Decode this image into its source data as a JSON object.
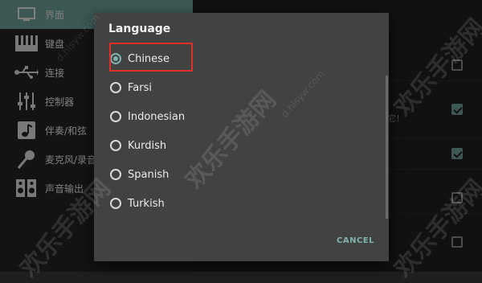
{
  "sidebar": {
    "items": [
      {
        "label": "界面",
        "icon": "display-icon"
      },
      {
        "label": "键盘",
        "icon": "piano-keys-icon"
      },
      {
        "label": "连接",
        "icon": "usb-icon"
      },
      {
        "label": "控制器",
        "icon": "sliders-icon"
      },
      {
        "label": "伴奏/和弦",
        "icon": "music-note-icon"
      },
      {
        "label": "麦克风/录音",
        "icon": "microphone-icon"
      },
      {
        "label": "声音输出",
        "icon": "speaker-icon"
      }
    ]
  },
  "background": {
    "partial_text": "它！",
    "checkboxes": [
      {
        "checked": false
      },
      {
        "checked": true
      },
      {
        "checked": true
      },
      {
        "checked": false
      },
      {
        "checked": false
      }
    ]
  },
  "dialog": {
    "title": "Language",
    "options": [
      {
        "label": "Chinese",
        "selected": true
      },
      {
        "label": "Farsi",
        "selected": false
      },
      {
        "label": "Indonesian",
        "selected": false
      },
      {
        "label": "Kurdish",
        "selected": false
      },
      {
        "label": "Spanish",
        "selected": false
      },
      {
        "label": "Turkish",
        "selected": false
      }
    ],
    "cancel_label": "CANCEL"
  },
  "watermark": {
    "text": "欢乐手游网",
    "url": "d.hlsyw.com"
  },
  "colors": {
    "accent": "#7fb3ad",
    "highlight": "#e0302a",
    "active_sidebar": "#6e9f9a"
  }
}
